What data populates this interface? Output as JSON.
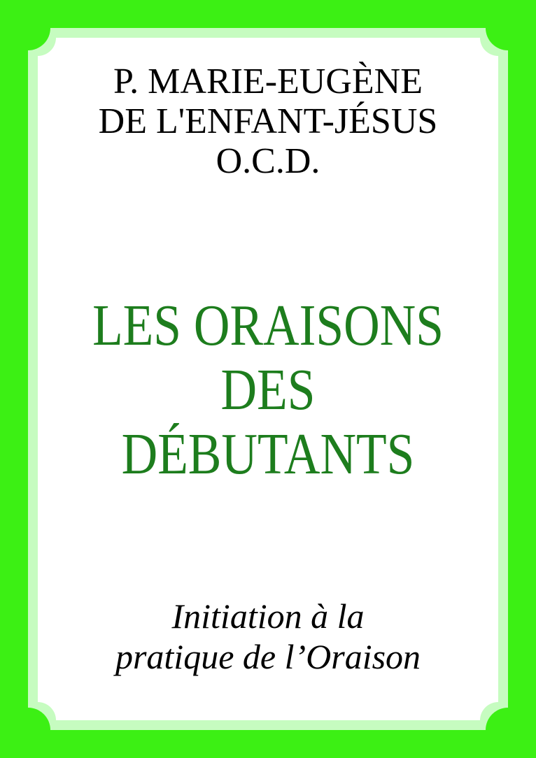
{
  "cover": {
    "colors": {
      "background": "#3cf014",
      "frame": "#c6fcc0",
      "panel": "#ffffff",
      "title": "#1d7d1d",
      "text": "#000000"
    },
    "author_lines": [
      "P. MARIE-EUGÈNE",
      "DE L'ENFANT-JÉSUS",
      "O.C.D."
    ],
    "title_lines": [
      "LES ORAISONS",
      "DES",
      "DÉBUTANTS"
    ],
    "subtitle_lines": [
      "Initiation à la",
      "pratique de l’Oraison"
    ]
  }
}
